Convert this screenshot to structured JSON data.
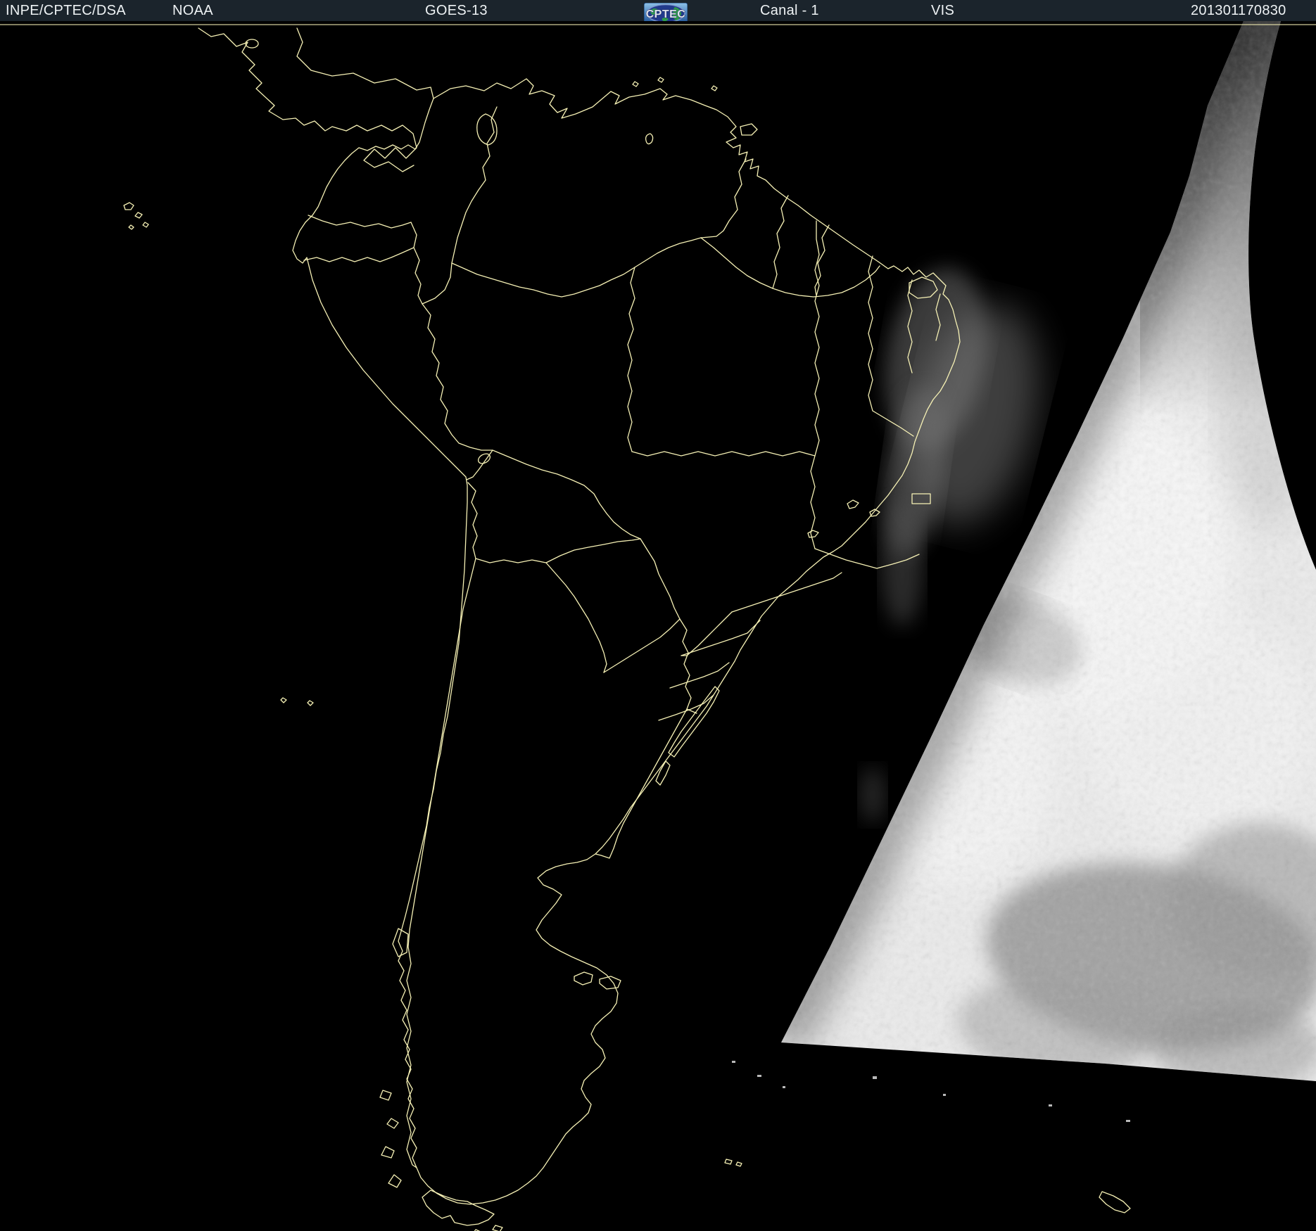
{
  "header": {
    "bg_color": "#1b242c",
    "text_color": "#eef2f4",
    "agency": "INPE/CPTEC/DSA",
    "noaa": "NOAA",
    "satellite": "GOES-13",
    "channel": "Canal - 1",
    "band": "VIS",
    "timestamp": "201301170830",
    "logo_text": "CPTEC",
    "logo_colors": {
      "sky_blue": "#7fb2dc",
      "deep_blue": "#1d4f93",
      "globe_navy": "#223a8c",
      "land_green": "#2e9e4a",
      "letter_silver": "#dfe3ec"
    }
  },
  "map": {
    "background_color": "#000000",
    "border_line_color": "#f6f1b5",
    "graticule_line_color": "#f6f1b5",
    "day_region_color": "#ebebeb",
    "cloud_gray": "#8f8f8f",
    "icons": {
      "coastline": "south-america-coastline",
      "day_region": "sunlit-terminator-region",
      "limb": "earth-limb-dark-region"
    }
  }
}
